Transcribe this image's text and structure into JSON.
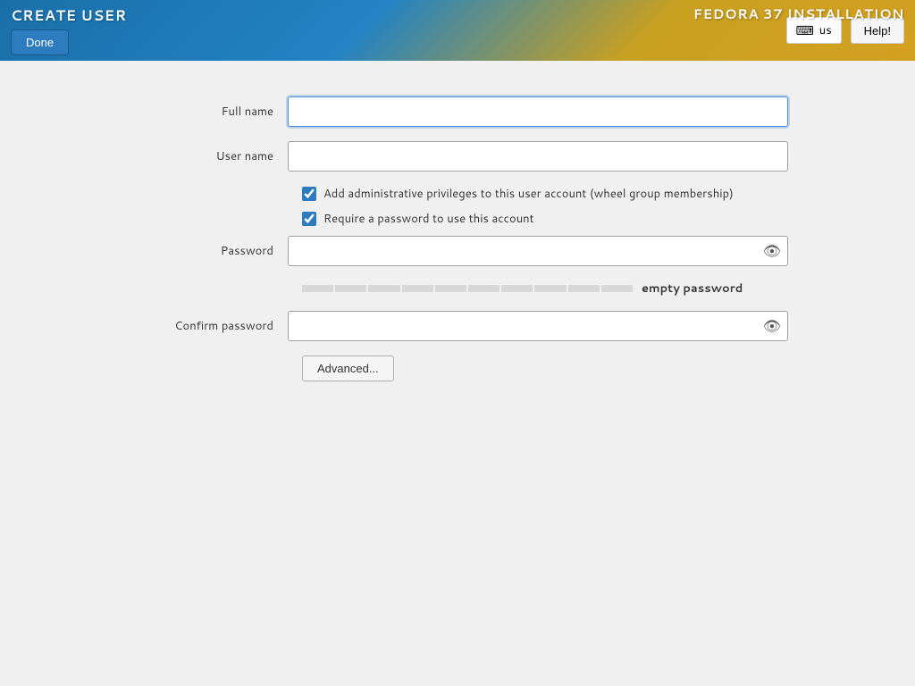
{
  "header": {
    "page_title": "CREATE USER",
    "app_title": "FEDORA 37 INSTALLATION",
    "done_button_label": "Done",
    "help_button_label": "Help!",
    "keyboard_layout": "us",
    "keyboard_icon": "⌨"
  },
  "form": {
    "full_name_label": "Full name",
    "full_name_value": "",
    "user_name_label": "User name",
    "user_name_value": "",
    "admin_checkbox_label": "Add administrative privileges to this user account (wheel group membership)",
    "admin_checked": true,
    "require_password_label": "Require a password to use this account",
    "require_password_checked": true,
    "password_label": "Password",
    "password_value": "",
    "password_strength_label": "empty password",
    "confirm_password_label": "Confirm password",
    "confirm_password_value": "",
    "advanced_button_label": "Advanced..."
  }
}
